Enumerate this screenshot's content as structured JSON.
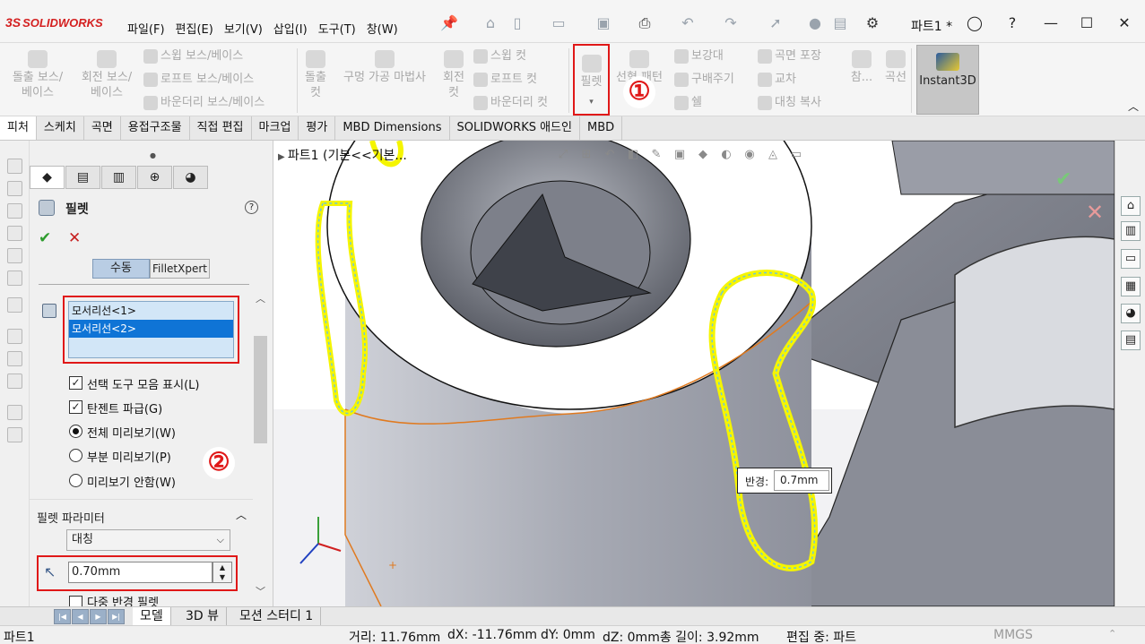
{
  "app": {
    "logo": "SOLIDWORKS",
    "document_title": "파트1 *"
  },
  "menu": [
    "파일(F)",
    "편집(E)",
    "보기(V)",
    "삽입(I)",
    "도구(T)",
    "창(W)"
  ],
  "ribbon": {
    "extrude_boss": "돌출 보스/베이스",
    "revolve_boss": "회전 보스/베이스",
    "sweep_boss": "스윕 보스/베이스",
    "loft_boss": "로프트 보스/베이스",
    "boundary_boss": "바운더리 보스/베이스",
    "extrude_cut": "돌출 컷",
    "hole_wizard": "구멍 가공 마법사",
    "revolve_cut": "회전 컷",
    "sweep_cut": "스윕 컷",
    "loft_cut": "로프트 컷",
    "boundary_cut": "바운더리 컷",
    "fillet": "필렛",
    "linear_pattern": "선형 패턴",
    "rib": "보강대",
    "draft": "구배주기",
    "shell": "쉘",
    "wrap": "곡면 포장",
    "intersect": "교차",
    "mirror": "대칭 복사",
    "reference": "참...",
    "curves": "곡선",
    "instant3d": "Instant3D",
    "marker1": "①"
  },
  "tabs": [
    "피처",
    "스케치",
    "곡면",
    "용접구조물",
    "직접 편집",
    "마크업",
    "평가",
    "MBD Dimensions",
    "SOLIDWORKS 애드인",
    "MBD"
  ],
  "property_manager": {
    "title": "필렛",
    "help": "?",
    "ok": "✔",
    "cancel": "✕",
    "mode_manual": "수동",
    "mode_filletxpert": "FilletXpert",
    "edges": [
      "모서리선<1>",
      "모서리선<2>"
    ],
    "options": {
      "show_toolbar": "선택 도구 모음 표시(L)",
      "tangent_propagation": "탄젠트 파급(G)",
      "full_preview": "전체 미리보기(W)",
      "partial_preview": "부분 미리보기(P)",
      "no_preview": "미리보기 안함(W)"
    },
    "marker2": "②",
    "fillet_params_label": "필렛 파라미터",
    "symmetric": "대칭",
    "radius_value": "0.70mm",
    "multi_radius": "다중 반경 필렛"
  },
  "viewport": {
    "tree_flyout": "파트1  (기본<<기본...",
    "radius_label": "반경:",
    "radius_value": "0.7mm"
  },
  "bottom_tabs": [
    "모델",
    "3D 뷰",
    "모션 스터디 1"
  ],
  "status": {
    "doc": "파트1",
    "distance": "거리: 11.76mm",
    "dx": "dX: -11.76mm",
    "dy": "dY: 0mm",
    "dz": "dZ: 0mm총 길이: 3.92mm",
    "mode": "편집 중: 파트",
    "units": "MMGS"
  },
  "colors": {
    "accent_red": "#e01818",
    "selection_blue": "#0f74d6",
    "preview_yellow": "#f5f500"
  }
}
